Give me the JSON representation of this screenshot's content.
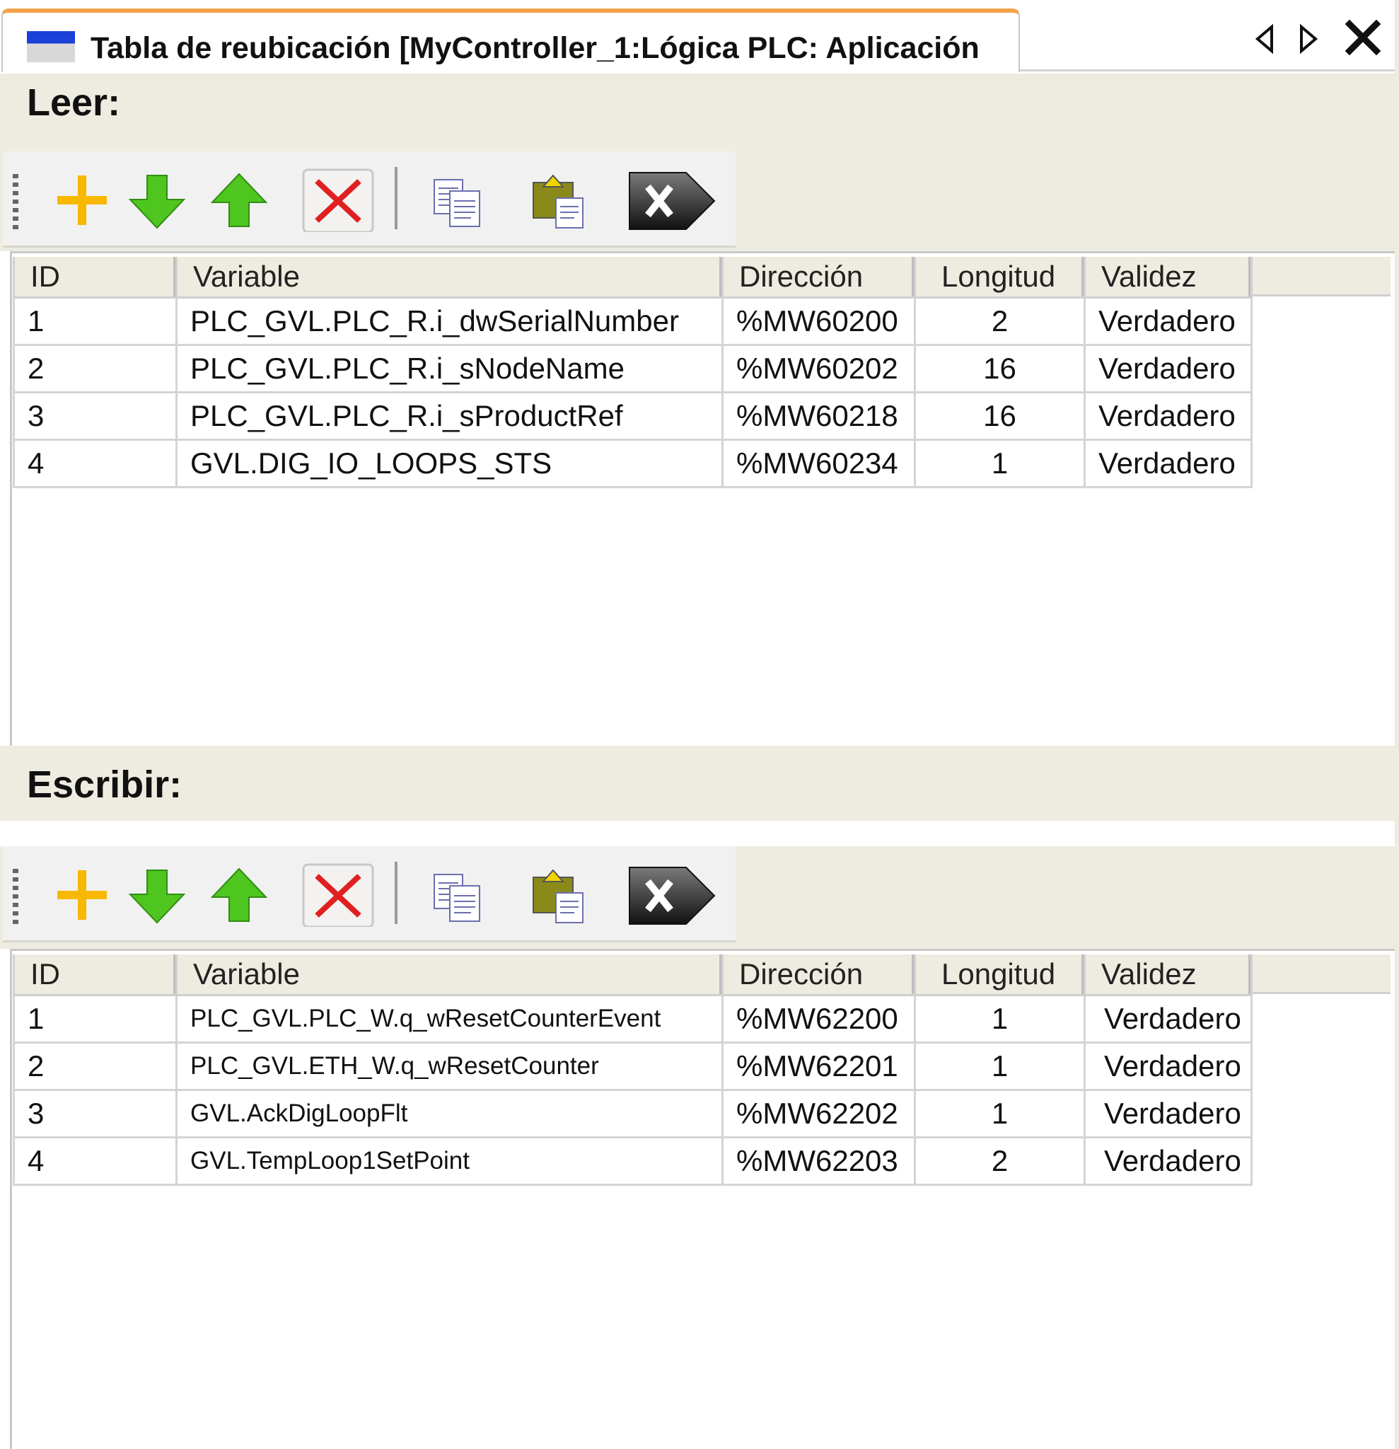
{
  "window": {
    "tab_title": "Tabla de reubicación [MyController_1:Lógica PLC: Aplicación",
    "nav_prev_icon": "triangle-left-icon",
    "nav_next_icon": "triangle-right-icon",
    "close_icon": "close-icon"
  },
  "toolbar": {
    "buttons": [
      {
        "icon": "add-icon",
        "color": "#f8b800"
      },
      {
        "icon": "move-down-icon",
        "color": "#3fbf1a"
      },
      {
        "icon": "move-up-icon",
        "color": "#3fbf1a"
      },
      {
        "icon": "delete-icon",
        "color": "#e02020"
      },
      {
        "icon": "copy-icon"
      },
      {
        "icon": "paste-icon"
      },
      {
        "icon": "clear-all-icon"
      }
    ]
  },
  "columns": [
    "ID",
    "Variable",
    "Dirección",
    "Longitud",
    "Validez"
  ],
  "read": {
    "label": "Leer:",
    "rows": [
      {
        "id": "1",
        "variable": "PLC_GVL.PLC_R.i_dwSerialNumber",
        "address": "%MW60200",
        "length": "2",
        "validity": "Verdadero"
      },
      {
        "id": "2",
        "variable": "PLC_GVL.PLC_R.i_sNodeName",
        "address": "%MW60202",
        "length": "16",
        "validity": "Verdadero"
      },
      {
        "id": "3",
        "variable": "PLC_GVL.PLC_R.i_sProductRef",
        "address": "%MW60218",
        "length": "16",
        "validity": "Verdadero"
      },
      {
        "id": "4",
        "variable": "GVL.DIG_IO_LOOPS_STS",
        "address": "%MW60234",
        "length": "1",
        "validity": "Verdadero"
      }
    ]
  },
  "write": {
    "label": "Escribir:",
    "rows": [
      {
        "id": "1",
        "variable": "PLC_GVL.PLC_W.q_wResetCounterEvent",
        "address": "%MW62200",
        "length": "1",
        "validity": "Verdadero"
      },
      {
        "id": "2",
        "variable": "PLC_GVL.ETH_W.q_wResetCounter",
        "address": "%MW62201",
        "length": "1",
        "validity": "Verdadero"
      },
      {
        "id": "3",
        "variable": "GVL.AckDigLoopFlt",
        "address": "%MW62202",
        "length": "1",
        "validity": "Verdadero"
      },
      {
        "id": "4",
        "variable": "GVL.TempLoop1SetPoint",
        "address": "%MW62203",
        "length": "2",
        "validity": "Verdadero"
      }
    ]
  }
}
